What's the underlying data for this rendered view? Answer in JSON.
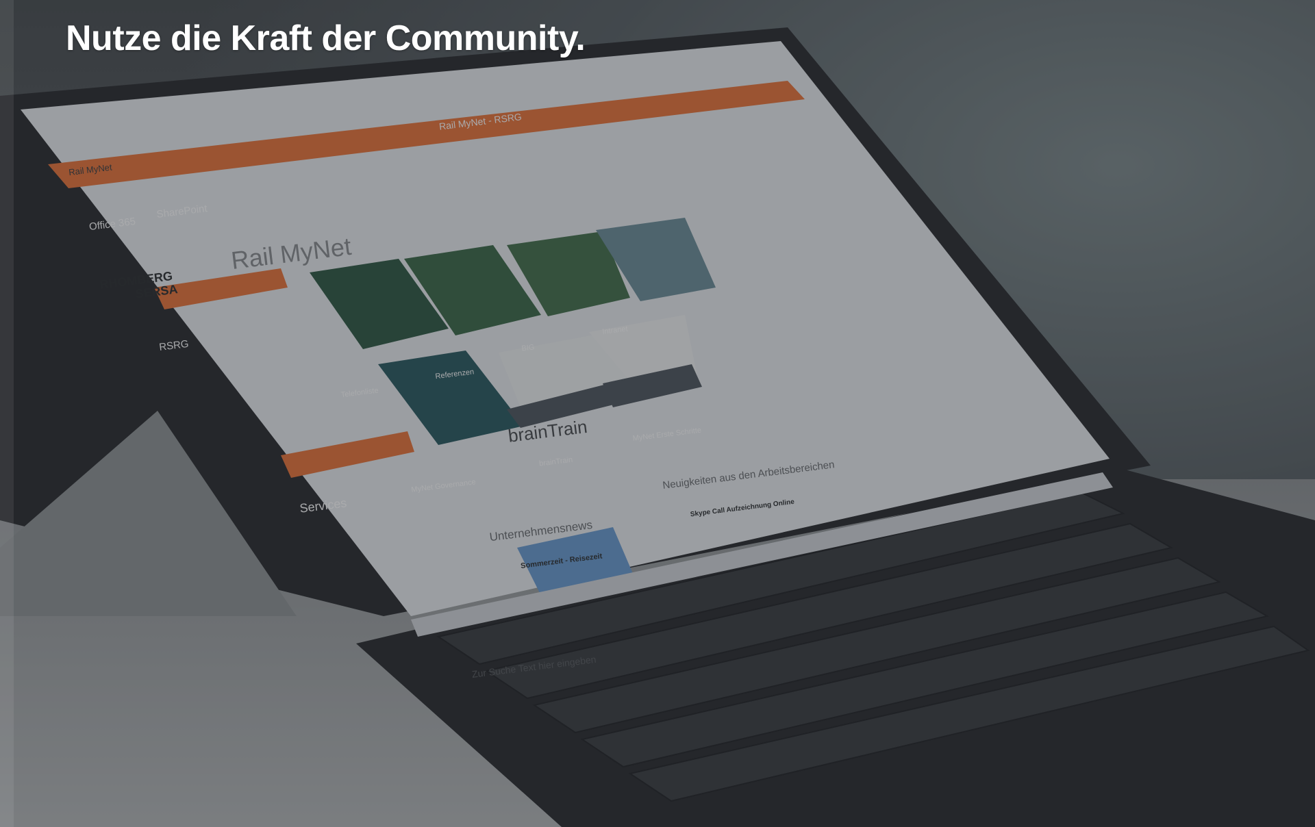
{
  "headline": "Nutze die Kraft der Community.",
  "screen": {
    "browser_tab": "Rail MyNet",
    "suite_title": "Rail MyNet - RSRG",
    "nav_office": "Office 365",
    "nav_sharepoint": "SharePoint",
    "logo_line1": "RHOMBERG",
    "logo_line2": "SERSA",
    "site_title": "Rail MyNet",
    "sidebar_section1": "RSRG",
    "sidebar_section2": "Services",
    "tiles": [
      "Telefonliste",
      "Referenzen",
      "BIG",
      "Intranet",
      "MyNet Governance",
      "brainTrain",
      "MyNet Erste Schritte"
    ],
    "braintrain_logo": "brainTrain",
    "news_heading": "Unternehmensnews",
    "news_item": "Sommerzeit - Reisezeit",
    "news_from_areas": "Neuigkeiten aus den Arbeitsbereichen",
    "skype_item": "Skype Call Aufzeichnung Online",
    "search_placeholder": "Zur Suche Text hier eingeben"
  },
  "colors": {
    "accent_orange": "#e8743b",
    "headline": "#ffffff"
  }
}
